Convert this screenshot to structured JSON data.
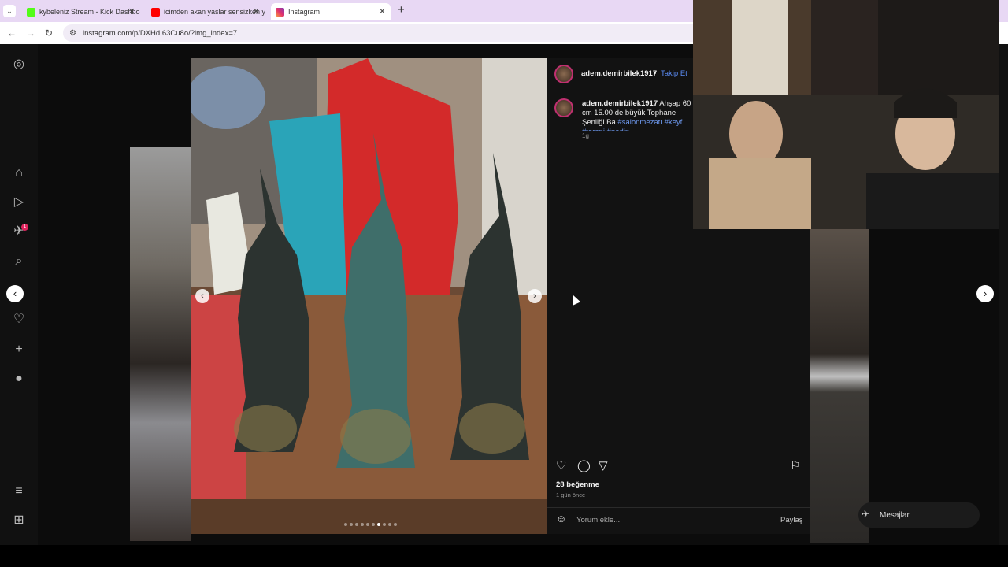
{
  "browser": {
    "tabs": [
      {
        "title": "kybeleniz Stream - Kick Dashbo",
        "favicon_color": "#53fc18",
        "active": false
      },
      {
        "title": "icimden akan yaslar sensizken y",
        "favicon_color": "#ff0000",
        "active": false
      },
      {
        "title": "Instagram",
        "favicon_color": "#e1306c",
        "active": true
      }
    ],
    "new_tab": "+",
    "url": "instagram.com/p/DXHdI63Cu8o/?img_index=7"
  },
  "post": {
    "username": "adem.demirbilek1917",
    "separator": "•",
    "follow_label": "Takip Et",
    "caption_user": "adem.demirbilek1917",
    "caption_text": "Ahşap 60 cm 15.00 de büyük Tophane Şenliği Ba",
    "caption_tags": "#salonmezatı #keyf #terapi #nadin",
    "caption_age": "1g",
    "likes": "28 beğenme",
    "post_age": "1 gün önce",
    "comment_placeholder": "Yorum ekle...",
    "share_label": "Paylaş",
    "carousel": {
      "count": 10,
      "current": 7
    }
  },
  "messages": {
    "label": "Mesajlar",
    "badge": "1"
  },
  "sidebar_badge": "1",
  "colors": {
    "accent_link": "#5b8cf5",
    "badge": "#e0245e",
    "tab_bar": "#e8d8f4"
  }
}
